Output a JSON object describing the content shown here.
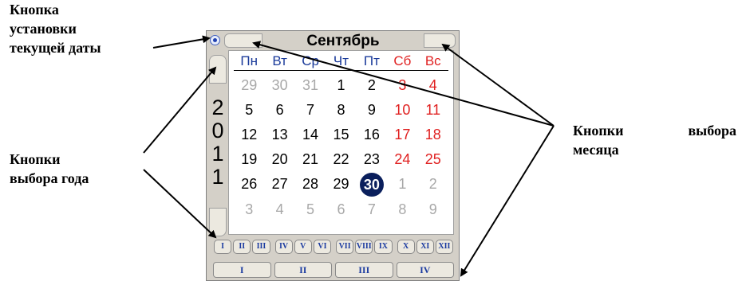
{
  "annotations": {
    "today_button": [
      "Кнопка",
      "установки",
      "текущей даты"
    ],
    "year_buttons": [
      "Кнопки",
      "выбора года"
    ],
    "month_buttons": {
      "line1_left": "Кнопки",
      "line1_right": "выбора",
      "line2": "месяца"
    }
  },
  "calendar": {
    "month": "Сентябрь",
    "year_digits": [
      "2",
      "0",
      "1",
      "1"
    ],
    "weekdays": [
      {
        "label": "Пн",
        "weekend": false
      },
      {
        "label": "Вт",
        "weekend": false
      },
      {
        "label": "Ср",
        "weekend": false
      },
      {
        "label": "Чт",
        "weekend": false
      },
      {
        "label": "Пт",
        "weekend": false
      },
      {
        "label": "Сб",
        "weekend": true
      },
      {
        "label": "Вс",
        "weekend": true
      }
    ],
    "weeks": [
      [
        {
          "d": "29",
          "o": true
        },
        {
          "d": "30",
          "o": true
        },
        {
          "d": "31",
          "o": true
        },
        {
          "d": "1"
        },
        {
          "d": "2"
        },
        {
          "d": "3",
          "w": true
        },
        {
          "d": "4",
          "w": true
        }
      ],
      [
        {
          "d": "5"
        },
        {
          "d": "6"
        },
        {
          "d": "7"
        },
        {
          "d": "8"
        },
        {
          "d": "9"
        },
        {
          "d": "10",
          "w": true
        },
        {
          "d": "11",
          "w": true
        }
      ],
      [
        {
          "d": "12"
        },
        {
          "d": "13"
        },
        {
          "d": "14"
        },
        {
          "d": "15"
        },
        {
          "d": "16"
        },
        {
          "d": "17",
          "w": true
        },
        {
          "d": "18",
          "w": true
        }
      ],
      [
        {
          "d": "19"
        },
        {
          "d": "20"
        },
        {
          "d": "21"
        },
        {
          "d": "22"
        },
        {
          "d": "23"
        },
        {
          "d": "24",
          "w": true
        },
        {
          "d": "25",
          "w": true
        }
      ],
      [
        {
          "d": "26"
        },
        {
          "d": "27"
        },
        {
          "d": "28"
        },
        {
          "d": "29"
        },
        {
          "d": "30",
          "sel": true
        },
        {
          "d": "1",
          "o": true
        },
        {
          "d": "2",
          "o": true
        }
      ],
      [
        {
          "d": "3",
          "o": true
        },
        {
          "d": "4",
          "o": true
        },
        {
          "d": "5",
          "o": true
        },
        {
          "d": "6",
          "o": true
        },
        {
          "d": "7",
          "o": true
        },
        {
          "d": "8",
          "o": true
        },
        {
          "d": "9",
          "o": true
        }
      ]
    ],
    "month_buttons": [
      "I",
      "II",
      "III",
      "IV",
      "V",
      "VI",
      "VII",
      "VIII",
      "IX",
      "X",
      "XI",
      "XII"
    ],
    "quarter_buttons": [
      "I",
      "II",
      "III",
      "IV"
    ]
  },
  "colors": {
    "weekday": "#1a3a9a",
    "weekend": "#e02020",
    "other": "#a8a8a8",
    "selected": "#0a1f5c"
  }
}
